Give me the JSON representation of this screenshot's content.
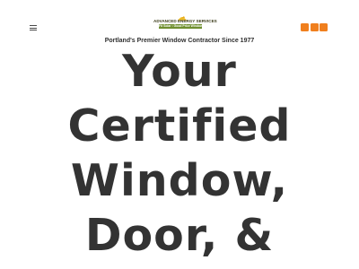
{
  "header": {
    "menu_icon": "hamburger-icon",
    "logo": {
      "title": "ADVANCED ENERGY SERVICES",
      "tagline": "Fit Solar • Good Price Windows"
    },
    "action_buttons": [
      {
        "icon": "orange-square",
        "color": "#f07f1e"
      },
      {
        "icon": "orange-square",
        "color": "#f07f1e"
      },
      {
        "icon": "orange-square",
        "color": "#f07f1e"
      }
    ]
  },
  "subtitle": "Portland's Premier Window Contractor Since 1977",
  "hero": {
    "lines": [
      "Your",
      "Certified",
      "Window,",
      "Door, &"
    ]
  },
  "colors": {
    "accent": "#f07f1e",
    "logo_green": "#6f8f2e",
    "text": "#333333"
  }
}
